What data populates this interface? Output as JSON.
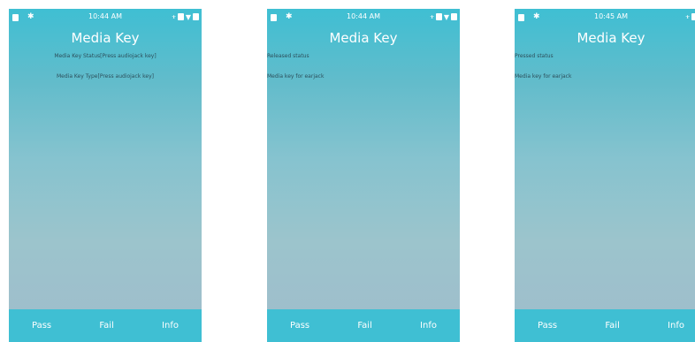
{
  "screens": [
    {
      "status_time": "10:44 AM",
      "title": "Media Key",
      "line1": "Media Key Status[Press audiojack key]",
      "line2": "Media Key Type[Press audiojack key]",
      "pass_label": "Pass",
      "fail_label": "Fail",
      "info_label": "Info"
    },
    {
      "status_time": "10:44 AM",
      "title": "Media Key",
      "line1": "Released status",
      "line2": "Media key for earjack",
      "pass_label": "Pass",
      "fail_label": "Fail",
      "info_label": "Info"
    },
    {
      "status_time": "10:45 AM",
      "title": "Media Key",
      "line1": "Pressed status",
      "line2": "Media key for earjack",
      "pass_label": "Pass",
      "fail_label": "Fail",
      "info_label": "Info"
    }
  ],
  "colors": {
    "accent": "#3fbfd3",
    "text_dark": "#2d4f5b",
    "white": "#ffffff"
  },
  "icons": [
    "file-icon",
    "bluetooth-icon",
    "usb-icon",
    "headset-icon",
    "location-icon",
    "battery-icon"
  ]
}
